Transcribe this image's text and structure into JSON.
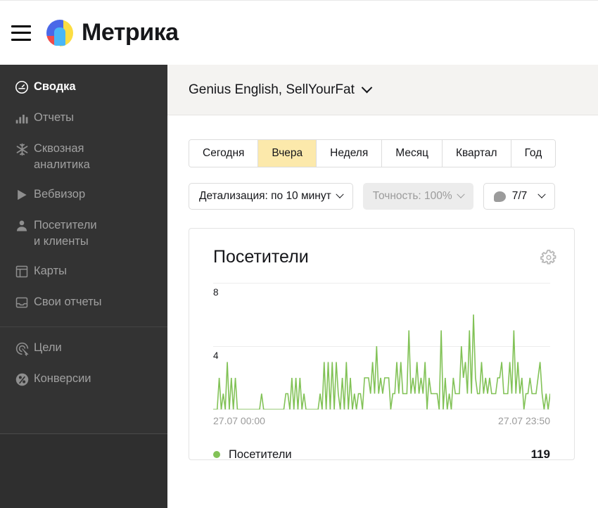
{
  "app": {
    "brand": "Метрика",
    "menu_icon": "hamburger-icon",
    "logo_icon": "metrika-logo-icon"
  },
  "sidebar": {
    "items": [
      {
        "label": "Сводка",
        "icon": "gauge-icon",
        "active": true
      },
      {
        "label": "Отчеты",
        "icon": "bar-chart-icon",
        "active": false
      },
      {
        "label": "Сквозная\nаналитика",
        "icon": "snowflake-icon",
        "active": false
      },
      {
        "label": "Вебвизор",
        "icon": "play-icon",
        "active": false
      },
      {
        "label": "Посетители\nи клиенты",
        "icon": "person-icon",
        "active": false
      },
      {
        "label": "Карты",
        "icon": "layout-icon",
        "active": false
      },
      {
        "label": "Свои отчеты",
        "icon": "inbox-icon",
        "active": false
      }
    ],
    "items_secondary": [
      {
        "label": "Цели",
        "icon": "target-cursor-icon"
      },
      {
        "label": "Конверсии",
        "icon": "percent-circle-icon"
      }
    ]
  },
  "header": {
    "project": "Genius English, SellYourFat",
    "project_chevron": "chevron-down-icon"
  },
  "periods": {
    "options": [
      "Сегодня",
      "Вчера",
      "Неделя",
      "Месяц",
      "Квартал",
      "Год"
    ],
    "selected": "Вчера"
  },
  "controls": {
    "detail": "Детализация: по 10 минут",
    "accuracy": "Точность: 100%",
    "comments": "7/7",
    "comments_icon": "speech-bubble-icon"
  },
  "card": {
    "title": "Посетители",
    "settings_icon": "gear-icon"
  },
  "chart_data": {
    "type": "line",
    "title": "Посетители",
    "xlabel": "",
    "ylabel": "",
    "x_start_label": "27.07 00:00",
    "x_end_label": "27.07 23:50",
    "ylim": [
      0,
      8
    ],
    "yticks": [
      0,
      4,
      8
    ],
    "ytick_labels": [
      "",
      "4",
      "8"
    ],
    "grid": true,
    "legend_position": "bottom",
    "series": [
      {
        "name": "Посетители",
        "color": "#82c257",
        "total": 119,
        "values": [
          0,
          0,
          0,
          2,
          0,
          1,
          0,
          3,
          0,
          2,
          0,
          2,
          0,
          0,
          0,
          0,
          0,
          0,
          0,
          0,
          0,
          0,
          0,
          0,
          1,
          0,
          0,
          0,
          0,
          0,
          0,
          0,
          0,
          0,
          0,
          0,
          1,
          1,
          0,
          2,
          0,
          2,
          0,
          2,
          0,
          1,
          0,
          0,
          0,
          0,
          0,
          0,
          0,
          1,
          0,
          3,
          0,
          3,
          0,
          3,
          0,
          3,
          1,
          0,
          2,
          0,
          3,
          0,
          2,
          0,
          1,
          0,
          1,
          1,
          0,
          2,
          2,
          2,
          1,
          3,
          1,
          4,
          1,
          2,
          1,
          2,
          2,
          2,
          0,
          1,
          1,
          3,
          1,
          3,
          1,
          1,
          1,
          5,
          1,
          2,
          1,
          3,
          1,
          2,
          1,
          3,
          0,
          2,
          1,
          1,
          1,
          1,
          0,
          5,
          0,
          2,
          0,
          1,
          0,
          2,
          1,
          1,
          1,
          4,
          2,
          3,
          1,
          5,
          1,
          6,
          2,
          1,
          1,
          3,
          1,
          2,
          1,
          2,
          1,
          1,
          1,
          2,
          2,
          3,
          1,
          1,
          1,
          3,
          1,
          5,
          1,
          3,
          1,
          2,
          0,
          1,
          1,
          2,
          1,
          1,
          1,
          2,
          3,
          1,
          0,
          1,
          0,
          1
        ]
      }
    ]
  },
  "legend": {
    "name": "Посетители",
    "value": "119",
    "dot_color": "#82c257"
  }
}
